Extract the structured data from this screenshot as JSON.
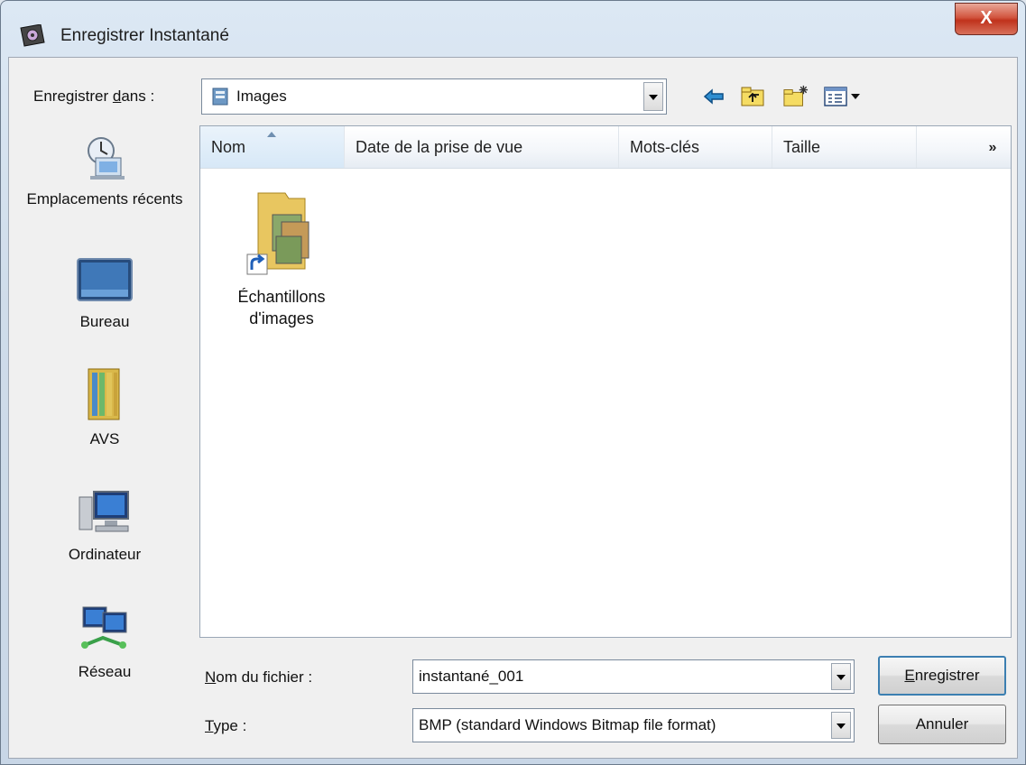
{
  "window": {
    "title": "Enregistrer Instantané",
    "close_label": "X"
  },
  "save_in": {
    "label_pre": "Enregistrer ",
    "label_accel": "d",
    "label_post": "ans :",
    "folder": "Images"
  },
  "toolbar": {
    "icons": [
      "back-arrow-icon",
      "up-folder-icon",
      "new-folder-icon",
      "view-menu-icon"
    ]
  },
  "places": [
    {
      "label": "Emplacements récents",
      "icon": "recent-places-icon"
    },
    {
      "label": "Bureau",
      "icon": "desktop-icon"
    },
    {
      "label": "AVS",
      "icon": "avs-folder-icon"
    },
    {
      "label": "Ordinateur",
      "icon": "computer-icon"
    },
    {
      "label": "Réseau",
      "icon": "network-icon"
    }
  ],
  "columns": [
    "Nom",
    "Date de la prise de vue",
    "Mots-clés",
    "Taille"
  ],
  "more_columns": "»",
  "files": [
    {
      "name_line1": "Échantillons",
      "name_line2": "d'images",
      "icon": "folder-shortcut-icon"
    }
  ],
  "filename": {
    "label_accel": "N",
    "label_rest": "om du fichier :",
    "value": "instantané_001"
  },
  "filetype": {
    "label_accel": "T",
    "label_rest": "ype :",
    "value": "BMP (standard Windows Bitmap file format)"
  },
  "buttons": {
    "save_accel": "E",
    "save_rest": "nregistrer",
    "cancel": "Annuler"
  }
}
